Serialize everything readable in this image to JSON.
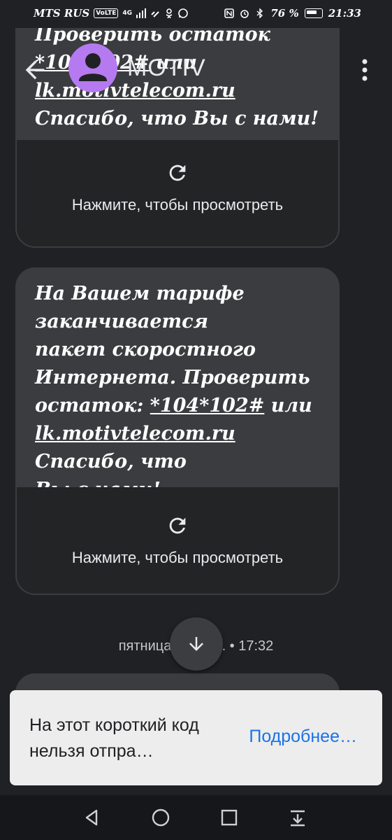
{
  "status_bar": {
    "carrier": "MTS RUS",
    "volte": "VoLTE",
    "network": "4G",
    "battery_percent": "76 %",
    "time": "21:33"
  },
  "app_bar": {
    "title": "MOTIV"
  },
  "messages": [
    {
      "text_html": "Проверить остаток <u>*104*102#</u> или <u>lk.motivtelecom.ru</u> Спасибо, что Вы с нами!",
      "action": "Нажмите, чтобы просмотреть"
    },
    {
      "lines": [
        "На Вашем тарифе",
        "заканчивается",
        "пакет скоростного",
        "Интернета. Проверить",
        "остаток: ",
        "*104*102#",
        " или",
        "lk.motivtelecom.ru",
        " Спасибо, что",
        "Вы с нами!"
      ],
      "action": "Нажмите, чтобы просмотреть"
    }
  ],
  "date_divider": "пятница, 1 нояб. • 17:32",
  "snackbar": {
    "message": "На этот короткий код нельзя отпра…",
    "action": "Подробнее…"
  },
  "colors": {
    "background": "#202125",
    "bubble": "#3b3c3f",
    "avatar": "#b67af0",
    "link": "#1a73e8"
  },
  "icons": [
    "back-arrow-icon",
    "contact-avatar-icon",
    "more-vert-icon",
    "refresh-icon",
    "arrow-down-icon",
    "nav-back-icon",
    "nav-home-icon",
    "nav-recents-icon",
    "nav-notifications-icon"
  ]
}
